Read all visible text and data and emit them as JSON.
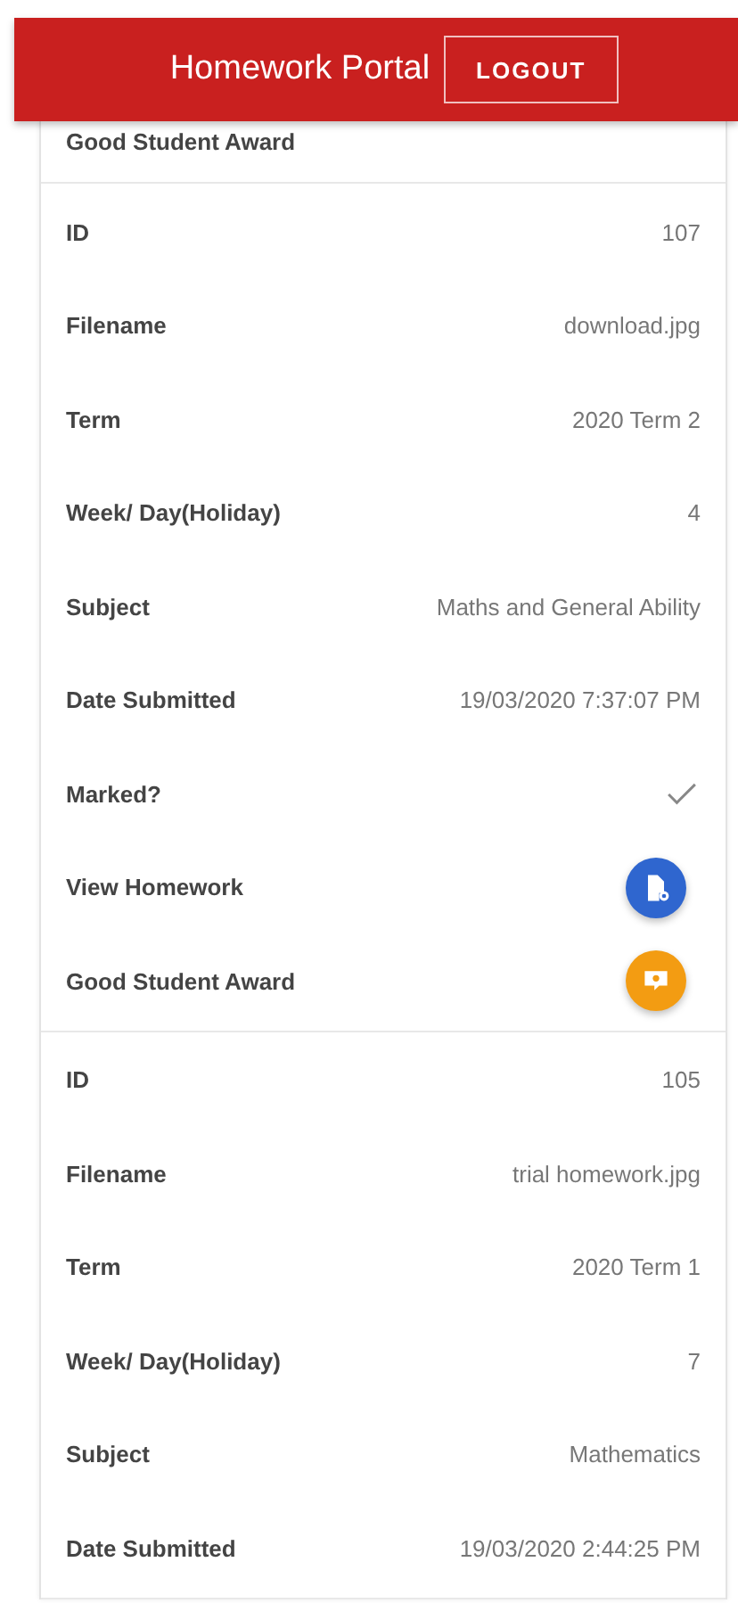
{
  "header": {
    "title": "Homework Portal",
    "logout_button": "LOGOUT"
  },
  "records": [
    {
      "rows": [
        {
          "kind": "label",
          "label": "Good Student Award"
        }
      ]
    },
    {
      "rows": [
        {
          "kind": "text",
          "label": "ID",
          "value": "107"
        },
        {
          "kind": "text",
          "label": "Filename",
          "value": "download.jpg"
        },
        {
          "kind": "text",
          "label": "Term",
          "value": "2020 Term 2"
        },
        {
          "kind": "text",
          "label": "Week/ Day(Holiday)",
          "value": "4"
        },
        {
          "kind": "text",
          "label": "Subject",
          "value": "Maths and General Ability"
        },
        {
          "kind": "text",
          "label": "Date Submitted",
          "value": "19/03/2020 7:37:07 PM"
        },
        {
          "kind": "check",
          "label": "Marked?",
          "checked": true
        },
        {
          "kind": "view",
          "label": "View Homework"
        },
        {
          "kind": "award",
          "label": "Good Student Award"
        }
      ]
    },
    {
      "rows": [
        {
          "kind": "text",
          "label": "ID",
          "value": "105"
        },
        {
          "kind": "text",
          "label": "Filename",
          "value": "trial homework.jpg"
        },
        {
          "kind": "text",
          "label": "Term",
          "value": "2020 Term 1"
        },
        {
          "kind": "text",
          "label": "Week/ Day(Holiday)",
          "value": "7"
        },
        {
          "kind": "text",
          "label": "Subject",
          "value": "Mathematics"
        },
        {
          "kind": "text",
          "label": "Date Submitted",
          "value": "19/03/2020 2:44:25 PM"
        }
      ]
    }
  ]
}
